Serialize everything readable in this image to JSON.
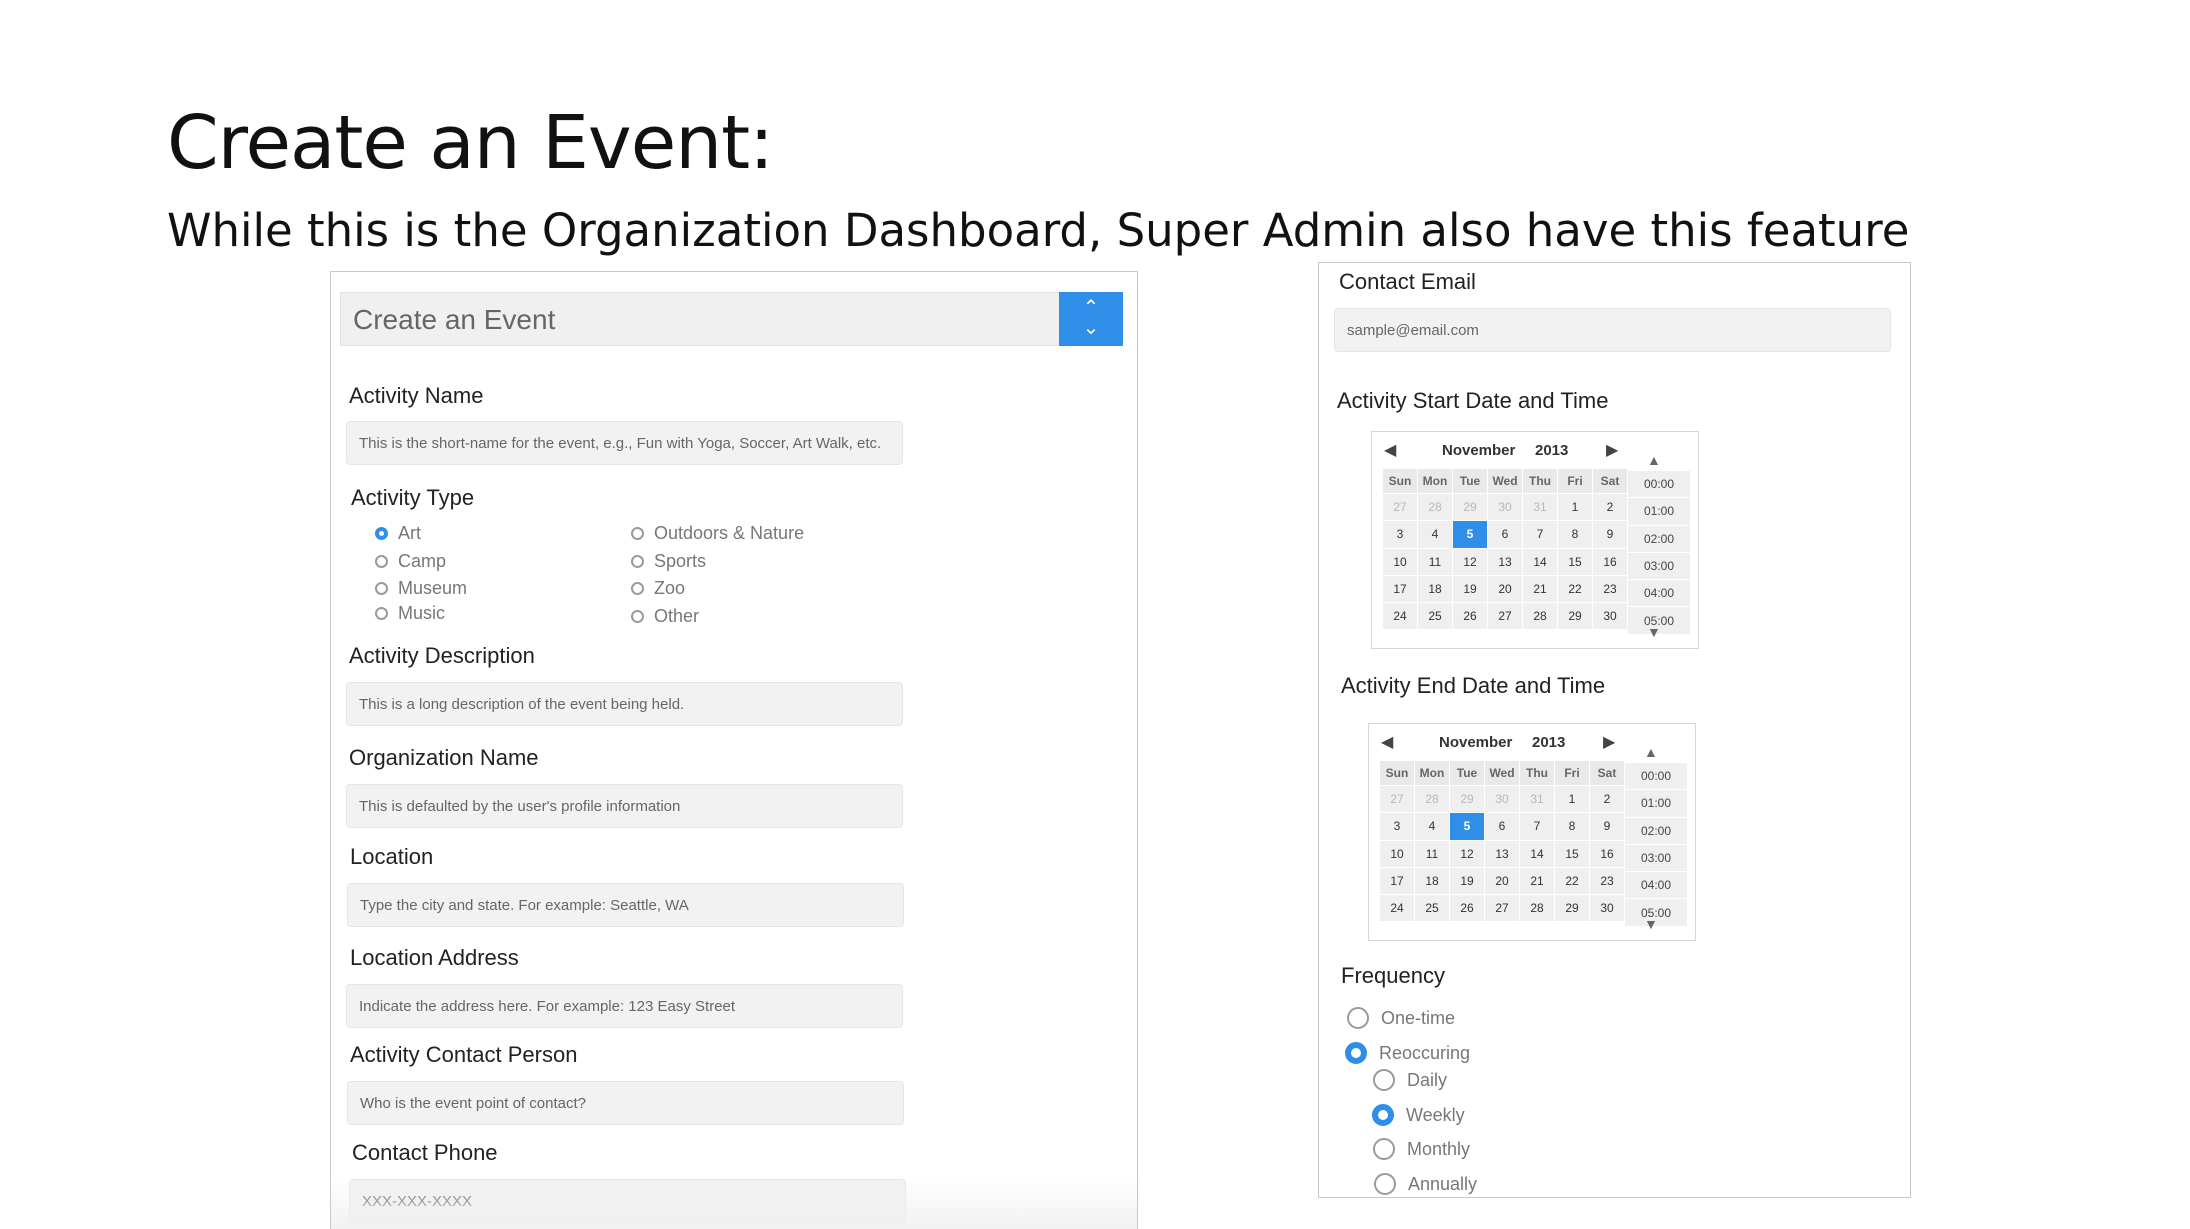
{
  "slide": {
    "title": "Create an Event:",
    "subtitle": "While this is the Organization Dashboard, Super Admin also have this feature"
  },
  "form": {
    "header_title": "Create an Event",
    "collapse_up": "⌃",
    "collapse_down": "⌄",
    "activity_name": {
      "label": "Activity Name",
      "placeholder": "This is the short-name for the event, e.g., Fun with Yoga, Soccer, Art Walk, etc."
    },
    "activity_type": {
      "label": "Activity Type",
      "options": [
        "Art",
        "Camp",
        "Museum",
        "Music",
        "Outdoors & Nature",
        "Sports",
        "Zoo",
        "Other"
      ],
      "selected": "Art"
    },
    "activity_description": {
      "label": "Activity Description",
      "placeholder": "This is a long description of the event being held."
    },
    "organization_name": {
      "label": "Organization Name",
      "placeholder": "This is defaulted by the user's profile information"
    },
    "location": {
      "label": "Location",
      "placeholder": "Type the city and state. For example: Seattle, WA"
    },
    "location_address": {
      "label": "Location Address",
      "placeholder": "Indicate the address here. For example: 123 Easy Street"
    },
    "contact_person": {
      "label": "Activity Contact Person",
      "placeholder": "Who is the event point of contact?"
    },
    "contact_phone": {
      "label": "Contact Phone",
      "placeholder": "XXX-XXX-XXXX"
    },
    "contact_email": {
      "label": "Contact Email",
      "placeholder": "sample@email.com"
    },
    "start": {
      "label": "Activity Start Date and Time"
    },
    "end": {
      "label": "Activity End Date and Time"
    },
    "calendar": {
      "month": "November",
      "year": "2013",
      "prev": "◀",
      "next": "▶",
      "weekdays": [
        "Sun",
        "Mon",
        "Tue",
        "Wed",
        "Thu",
        "Fri",
        "Sat"
      ],
      "weeks": [
        [
          "27",
          "28",
          "29",
          "30",
          "31",
          "1",
          "2"
        ],
        [
          "3",
          "4",
          "5",
          "6",
          "7",
          "8",
          "9"
        ],
        [
          "10",
          "11",
          "12",
          "13",
          "14",
          "15",
          "16"
        ],
        [
          "17",
          "18",
          "19",
          "20",
          "21",
          "22",
          "23"
        ],
        [
          "24",
          "25",
          "26",
          "27",
          "28",
          "29",
          "30"
        ]
      ],
      "selected_day": "5",
      "times": [
        "00:00",
        "01:00",
        "02:00",
        "03:00",
        "04:00",
        "05:00"
      ],
      "time_up": "▲",
      "time_down": "▼"
    },
    "frequency": {
      "label": "Frequency",
      "options": [
        "One-time",
        "Reoccuring"
      ],
      "selected": "Reoccuring",
      "sub_options": [
        "Daily",
        "Weekly",
        "Monthly",
        "Annually"
      ],
      "sub_selected": "Weekly"
    },
    "accent_color": "#2f8fe8"
  }
}
